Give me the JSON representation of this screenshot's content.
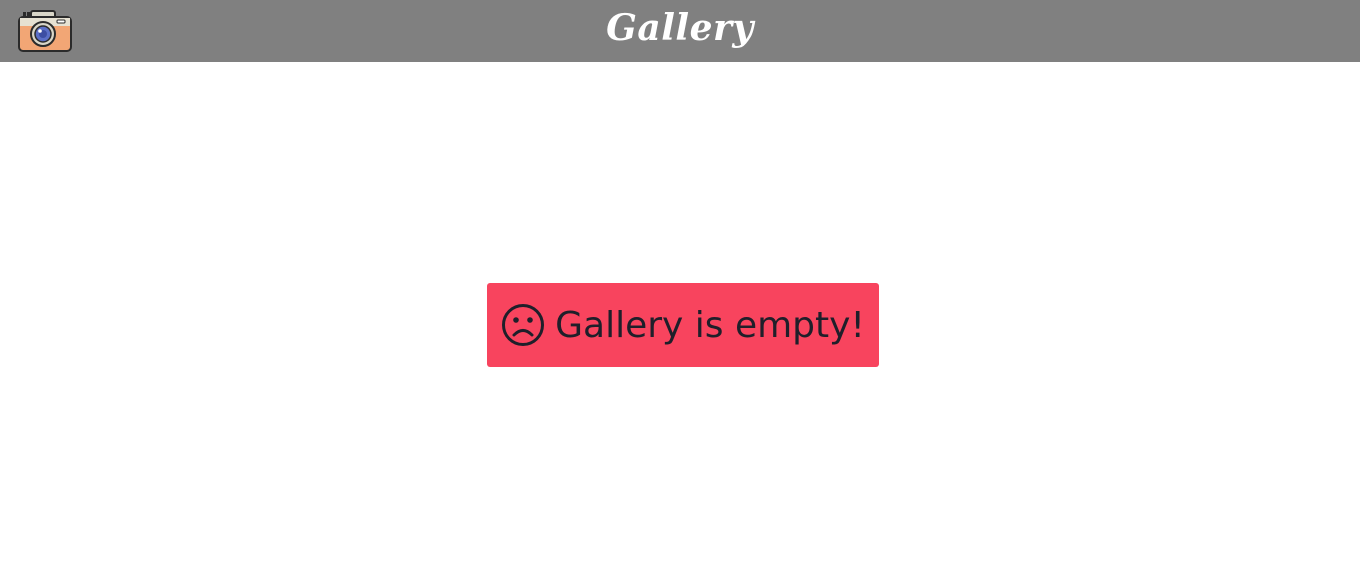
{
  "header": {
    "title": "Gallery",
    "logo_icon": "camera-icon",
    "background": "#808080"
  },
  "main": {
    "empty_message": "Gallery is empty!",
    "empty_icon": "sad-face-icon",
    "alert_color": "#f8445e"
  }
}
